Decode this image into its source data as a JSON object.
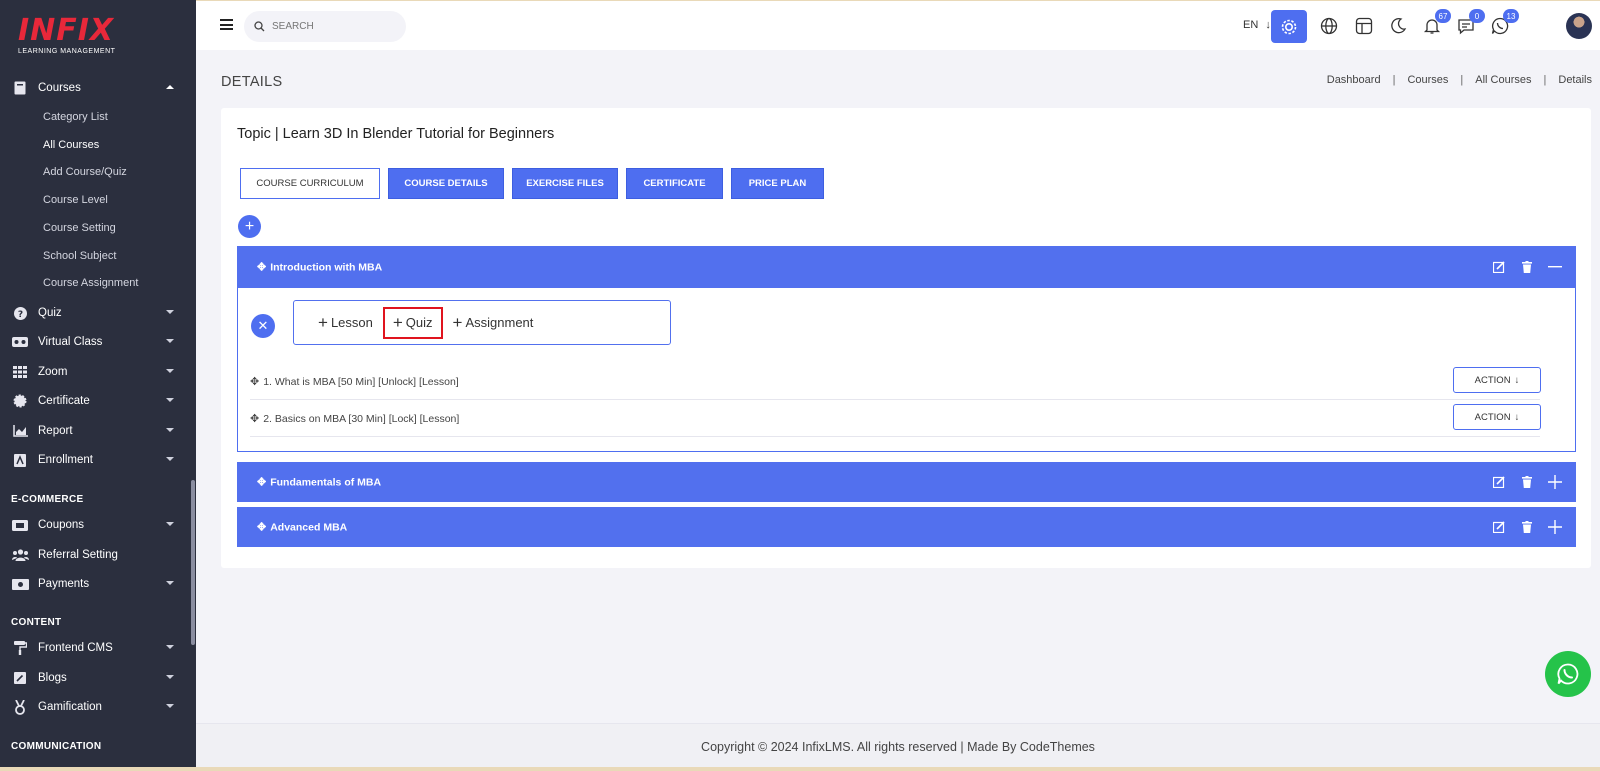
{
  "logo": {
    "main": "INFIX",
    "sub": "LEARNING MANAGEMENT"
  },
  "sidebar": {
    "courses": {
      "label": "Courses",
      "icon": "book-icon"
    },
    "sub_items": [
      "Category List",
      "All Courses",
      "Add Course/Quiz",
      "Course Level",
      "Course Setting",
      "School Subject",
      "Course Assignment"
    ],
    "active_sub": "All Courses",
    "items": [
      {
        "label": "Quiz",
        "icon": "question-icon"
      },
      {
        "label": "Virtual Class",
        "icon": "vr-icon"
      },
      {
        "label": "Zoom",
        "icon": "grid-icon"
      },
      {
        "label": "Certificate",
        "icon": "badge-icon"
      },
      {
        "label": "Report",
        "icon": "chart-icon"
      },
      {
        "label": "Enrollment",
        "icon": "enroll-icon"
      }
    ],
    "ecommerce_title": "E-COMMERCE",
    "ecommerce_items": [
      {
        "label": "Coupons",
        "icon": "coupon-icon"
      },
      {
        "label": "Referral Setting",
        "icon": "users-icon"
      },
      {
        "label": "Payments",
        "icon": "money-icon"
      }
    ],
    "content_title": "CONTENT",
    "content_items": [
      {
        "label": "Frontend CMS",
        "icon": "paint-roller-icon"
      },
      {
        "label": "Blogs",
        "icon": "pen-icon"
      },
      {
        "label": "Gamification",
        "icon": "medal-icon"
      }
    ],
    "communication_title": "COMMUNICATION"
  },
  "topbar": {
    "search_placeholder": "SEARCH",
    "language": "EN",
    "notifications_count": "67",
    "messages_count": "0",
    "whatsapp_count": "13"
  },
  "page": {
    "title": "DETAILS",
    "breadcrumb": [
      "Dashboard",
      "Courses",
      "All Courses",
      "Details"
    ]
  },
  "topic": {
    "title": "Topic | Learn 3D In Blender Tutorial for Beginners",
    "tabs": [
      "COURSE CURRICULUM",
      "COURSE DETAILS",
      "EXERCISE FILES",
      "CERTIFICATE",
      "PRICE PLAN"
    ],
    "active_tab": "COURSE CURRICULUM"
  },
  "sections": [
    {
      "title": "Introduction with MBA",
      "expanded": true
    },
    {
      "title": "Fundamentals of MBA",
      "expanded": false
    },
    {
      "title": "Advanced MBA",
      "expanded": false
    }
  ],
  "add_options": [
    "Lesson",
    "Quiz",
    "Assignment"
  ],
  "highlighted_option": "Quiz",
  "lessons": [
    {
      "title": "1. What is MBA [50 Min] [Unlock] [Lesson]",
      "action": "ACTION"
    },
    {
      "title": "2. Basics on MBA [30 Min] [Lock] [Lesson]",
      "action": "ACTION"
    }
  ],
  "footer": {
    "text": "Copyright © 2024 InfixLMS. All rights reserved | Made By CodeThemes"
  },
  "colors": {
    "primary": "#4e6ef0",
    "sidebar": "#2b2f3e",
    "highlight": "#e0141e",
    "whatsapp": "#25c34a"
  }
}
